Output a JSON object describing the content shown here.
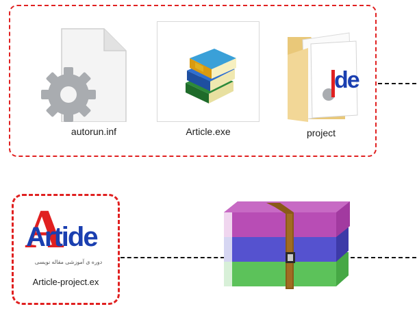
{
  "files": {
    "autorun": {
      "label": "autorun.inf",
      "icon": "settings-file-icon"
    },
    "article_exe": {
      "label": "Article.exe",
      "icon": "books-exe-icon"
    },
    "project": {
      "label": "project",
      "icon": "folder-icon"
    }
  },
  "sfx": {
    "label": "Article-project.ex",
    "logo_text": "Artide",
    "logo_subtext": "دوره ی آموزشی مقاله نویسی",
    "icon": "article-logo-icon"
  },
  "archive": {
    "icon": "winrar-archive-icon"
  },
  "folder_logo_text": "de",
  "colors": {
    "accent_red": "#e02020",
    "logo_blue": "#1a3fb0",
    "archive_purple": "#a23aa0",
    "archive_blue": "#4a47c8",
    "archive_green": "#46a845",
    "strap_brown": "#8a5a18"
  }
}
